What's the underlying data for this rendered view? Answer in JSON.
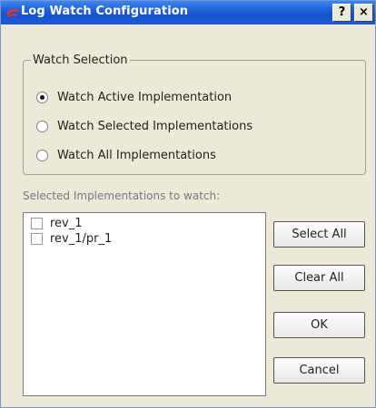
{
  "window": {
    "title": "Log Watch Configuration",
    "help_label": "?",
    "close_label": "×"
  },
  "watch_selection": {
    "legend": "Watch Selection",
    "options": [
      {
        "label": "Watch Active Implementation",
        "selected": true
      },
      {
        "label": "Watch Selected Implementations",
        "selected": false
      },
      {
        "label": "Watch All Implementations",
        "selected": false
      }
    ]
  },
  "implementations": {
    "label": "Selected Implementations to watch:",
    "items": [
      {
        "label": "rev_1",
        "checked": false
      },
      {
        "label": "rev_1/pr_1",
        "checked": false
      }
    ]
  },
  "buttons": {
    "select_all": "Select All",
    "clear_all": "Clear All",
    "ok": "OK",
    "cancel": "Cancel"
  },
  "colors": {
    "titlebar": "#1f5fd8",
    "dialog_bg": "#ece9d8",
    "app_icon": "#e8322c"
  }
}
